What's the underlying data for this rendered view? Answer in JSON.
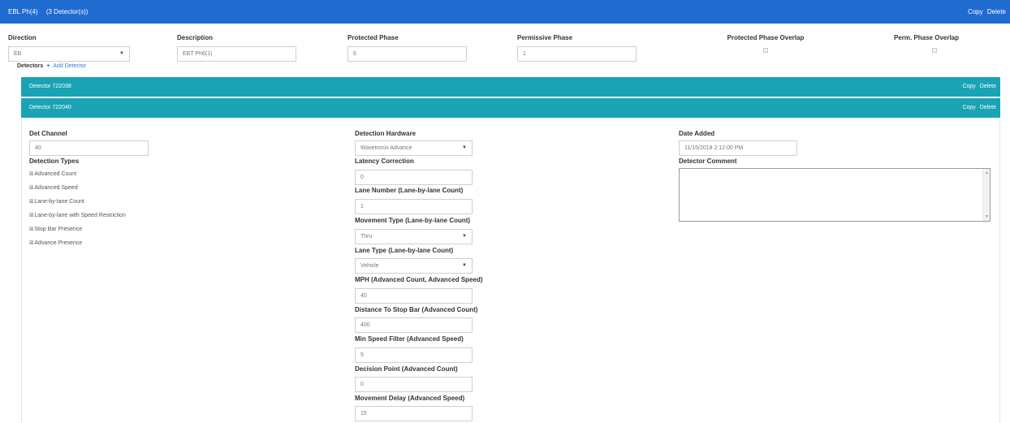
{
  "header": {
    "phase": "EBL Ph(4)",
    "detector_count": "(3 Detector(s))",
    "copy": "Copy",
    "delete": "Delete"
  },
  "approach": {
    "direction_label": "Direction",
    "direction_value": "EB",
    "description_label": "Description",
    "description_value": "EBT Ph6(1)",
    "protected_phase_label": "Protected Phase",
    "protected_phase_value": "6",
    "permissive_phase_label": "Permissive Phase",
    "permissive_phase_value": "1",
    "protected_overlap_label": "Protected Phase Overlap",
    "perm_overlap_label": "Perm. Phase Overlap"
  },
  "detectors_section": {
    "label": "Detectors",
    "plus": "+",
    "add_label": "Add Detector"
  },
  "detectors": [
    {
      "title": "Detector 722038",
      "copy": "Copy",
      "delete": "Delete"
    },
    {
      "title": "Detector 722040",
      "copy": "Copy",
      "delete": "Delete"
    }
  ],
  "detail": {
    "det_channel_label": "Det Channel",
    "det_channel_value": "40",
    "detection_types_label": "Detection Types",
    "detection_types": [
      "Advanced Count",
      "Advanced Speed",
      "Lane-by-lane Count",
      "Lane-by-lane with Speed Restriction",
      "Stop Bar Presence",
      "Advance Presence"
    ],
    "hardware_label": "Detection Hardware",
    "hardware_value": "Wavetronix Advance",
    "latency_label": "Latency Correction",
    "latency_value": "0",
    "lane_number_label": "Lane Number (Lane-by-lane Count)",
    "lane_number_value": "1",
    "movement_type_label": "Movement Type (Lane-by-lane Count)",
    "movement_type_value": "Thru",
    "lane_type_label": "Lane Type (Lane-by-lane Count)",
    "lane_type_value": "Vehicle",
    "mph_label": "MPH (Advanced Count, Advanced Speed)",
    "mph_value": "40",
    "distance_label": "Distance To Stop Bar (Advanced Count)",
    "distance_value": "400",
    "min_speed_label": "Min Speed Filter (Advanced Speed)",
    "min_speed_value": "5",
    "decision_label": "Decision Point (Advanced Count)",
    "decision_value": "0",
    "movement_delay_label": "Movement Delay (Advanced Speed)",
    "movement_delay_value": "15",
    "date_added_label": "Date Added",
    "date_added_value": "11/15/2018 2:12:00 PM",
    "comment_label": "Detector Comment"
  },
  "colors": {
    "header_blue": "#1f6bd0",
    "detector_teal": "#1aa3b5",
    "link_blue": "#3a7ad6"
  }
}
